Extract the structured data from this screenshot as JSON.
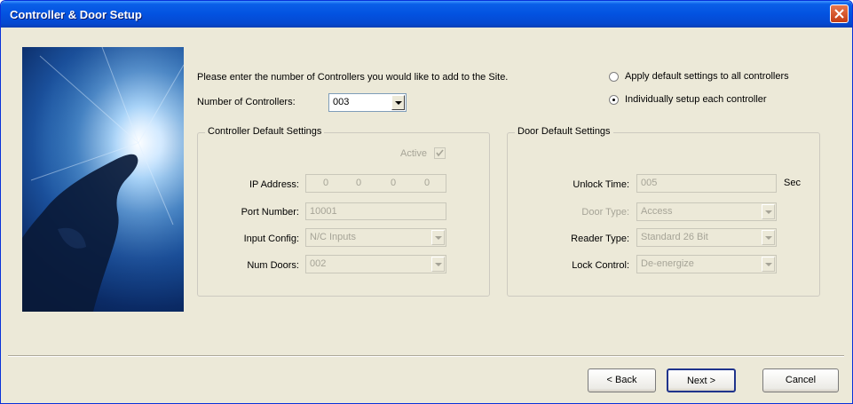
{
  "window": {
    "title": "Controller & Door Setup"
  },
  "instructions": "Please enter the number of Controllers you would like to add to the Site.",
  "num_controllers": {
    "label": "Number of Controllers:",
    "value": "003"
  },
  "setup_mode": {
    "options": [
      {
        "label": "Apply default settings to all controllers",
        "selected": false
      },
      {
        "label": "Individually setup each controller",
        "selected": true
      }
    ]
  },
  "controller_defaults": {
    "legend": "Controller Default Settings",
    "active_label": "Active",
    "active_checked": true,
    "ip_label": "IP Address:",
    "ip_octets": [
      "0",
      "0",
      "0",
      "0"
    ],
    "port_label": "Port Number:",
    "port_value": "10001",
    "input_config_label": "Input Config:",
    "input_config_value": "N/C Inputs",
    "num_doors_label": "Num Doors:",
    "num_doors_value": "002"
  },
  "door_defaults": {
    "legend": "Door Default Settings",
    "unlock_label": "Unlock Time:",
    "unlock_value": "005",
    "unlock_unit": "Sec",
    "door_type_label": "Door Type:",
    "door_type_value": "Access",
    "reader_type_label": "Reader Type:",
    "reader_type_value": "Standard 26 Bit",
    "lock_control_label": "Lock Control:",
    "lock_control_value": "De-energize"
  },
  "buttons": {
    "back": "< Back",
    "next": "Next >",
    "cancel": "Cancel"
  }
}
